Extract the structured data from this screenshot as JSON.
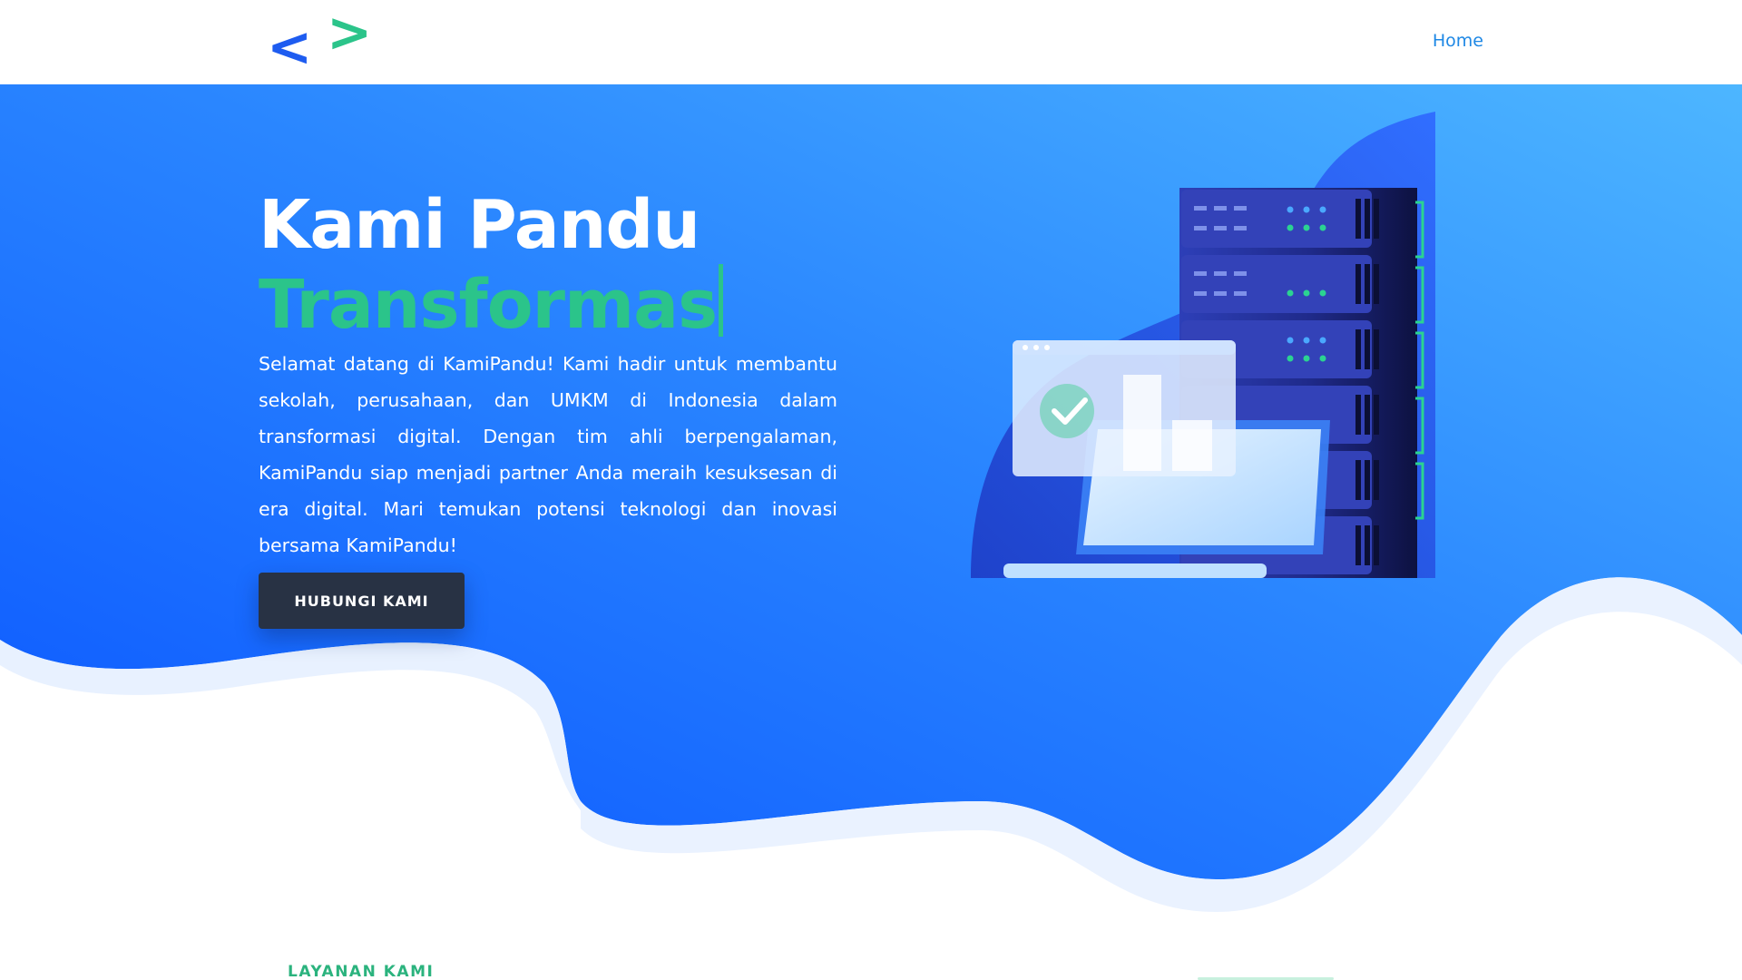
{
  "header": {
    "logo_left_glyph": "<",
    "logo_right_glyph": ">",
    "nav": [
      {
        "label": "Home"
      }
    ]
  },
  "hero": {
    "title_line1": "Kami Pandu",
    "title_line2_typed": "Transformas",
    "description": "Selamat datang di KamiPandu! Kami hadir untuk membantu sekolah, perusahaan, dan UMKM di Indonesia dalam transformasi digital. Dengan tim ahli berpengalaman, KamiPandu siap menjadi partner Anda meraih kesuksesan di era digital. Mari temukan potensi teknologi dan inovasi bersama KamiPandu!",
    "cta_label": "HUBUNGI KAMI"
  },
  "services": {
    "section_label": "LAYANAN KAMI"
  },
  "colors": {
    "brand_blue": "#1e5cf0",
    "brand_green": "#2bc48a",
    "nav_link": "#1e88e5",
    "cta_bg": "#283244"
  },
  "icons": [
    "logo-chevron-left-icon",
    "logo-chevron-right-icon",
    "check-icon",
    "server-rack-icon",
    "laptop-icon"
  ]
}
